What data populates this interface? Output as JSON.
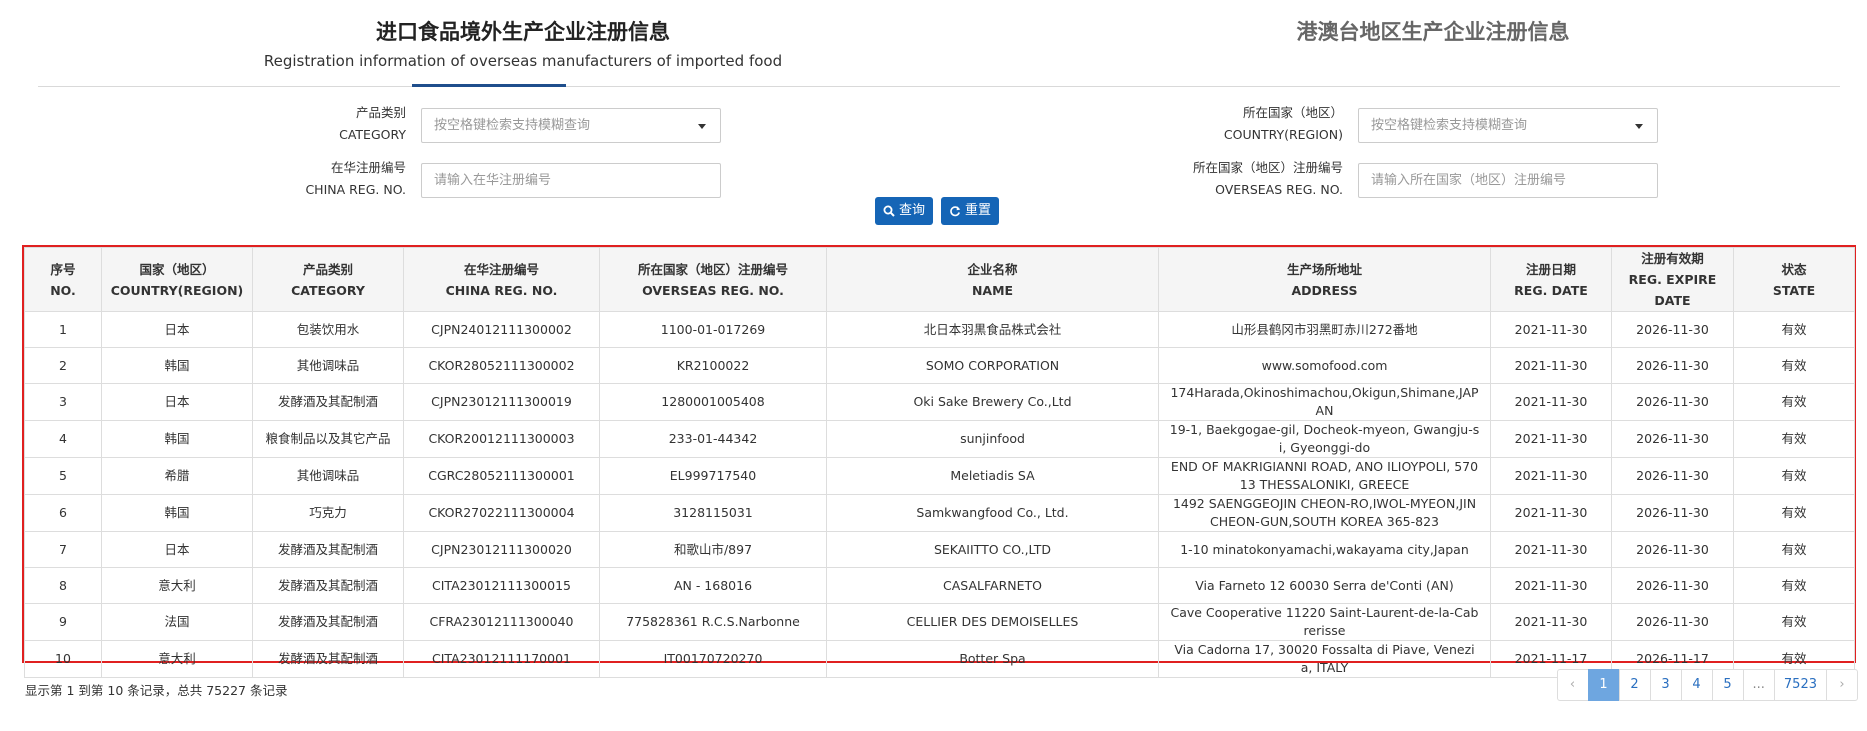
{
  "tabs": {
    "main_title": "进口食品境外生产企业注册信息",
    "main_subtitle": "Registration information of overseas manufacturers of imported food",
    "hk_title": "港澳台地区生产企业注册信息"
  },
  "filters": {
    "category_label_cn": "产品类别",
    "category_label_en": "CATEGORY",
    "category_placeholder": "按空格键检索支持模糊查询",
    "china_reg_label_cn": "在华注册编号",
    "china_reg_label_en": "CHINA REG. NO.",
    "china_reg_placeholder": "请输入在华注册编号",
    "country_label_cn": "所在国家（地区）",
    "country_label_en": "COUNTRY(REGION)",
    "country_placeholder": "按空格键检索支持模糊查询",
    "overseas_reg_label_cn": "所在国家（地区）注册编号",
    "overseas_reg_label_en": "OVERSEAS REG. NO.",
    "overseas_reg_placeholder": "请输入所在国家（地区）注册编号",
    "search_label": "查询",
    "reset_label": "重置"
  },
  "table": {
    "headers": [
      {
        "cn": "序号",
        "en": "NO."
      },
      {
        "cn": "国家（地区）",
        "en": "COUNTRY(REGION)"
      },
      {
        "cn": "产品类别",
        "en": "CATEGORY"
      },
      {
        "cn": "在华注册编号",
        "en": "CHINA REG. NO."
      },
      {
        "cn": "所在国家（地区）注册编号",
        "en": "OVERSEAS REG. NO."
      },
      {
        "cn": "企业名称",
        "en": "NAME"
      },
      {
        "cn": "生产场所地址",
        "en": "ADDRESS"
      },
      {
        "cn": "注册日期",
        "en": "REG. DATE"
      },
      {
        "cn": "注册有效期",
        "en": "REG. EXPIRE DATE"
      },
      {
        "cn": "状态",
        "en": "STATE"
      }
    ],
    "rows": [
      [
        "1",
        "日本",
        "包装饮用水",
        "CJPN24012111300002",
        "1100-01-017269",
        "北日本羽黒食品株式会社",
        "山形县鹤冈市羽黑町赤川272番地",
        "2021-11-30",
        "2026-11-30",
        "有效"
      ],
      [
        "2",
        "韩国",
        "其他调味品",
        "CKOR28052111300002",
        "KR2100022",
        "SOMO CORPORATION",
        "www.somofood.com",
        "2021-11-30",
        "2026-11-30",
        "有效"
      ],
      [
        "3",
        "日本",
        "发酵酒及其配制酒",
        "CJPN23012111300019",
        "1280001005408",
        "Oki Sake Brewery Co.,Ltd",
        "174Harada,Okinoshimachou,Okigun,Shimane,JAPAN",
        "2021-11-30",
        "2026-11-30",
        "有效"
      ],
      [
        "4",
        "韩国",
        "粮食制品以及其它产品",
        "CKOR20012111300003",
        "233-01-44342",
        "sunjinfood",
        "19-1, Baekgogae-gil, Docheok-myeon, Gwangju-si, Gyeonggi-do",
        "2021-11-30",
        "2026-11-30",
        "有效"
      ],
      [
        "5",
        "希腊",
        "其他调味品",
        "CGRC28052111300001",
        "EL999717540",
        "Meletiadis SA",
        "END OF MAKRIGIANNI ROAD, ANO ILIOYPOLI, 57013 THESSALONIKI, GREECE",
        "2021-11-30",
        "2026-11-30",
        "有效"
      ],
      [
        "6",
        "韩国",
        "巧克力",
        "CKOR27022111300004",
        "3128115031",
        "Samkwangfood Co., Ltd.",
        "1492 SAENGGEOJIN CHEON-RO,IWOL-MYEON,JINCHEON-GUN,SOUTH KOREA 365-823",
        "2021-11-30",
        "2026-11-30",
        "有效"
      ],
      [
        "7",
        "日本",
        "发酵酒及其配制酒",
        "CJPN23012111300020",
        "和歌山市/897",
        "SEKAIITTO CO.,LTD",
        "1-10 minatokonyamachi,wakayama city,Japan",
        "2021-11-30",
        "2026-11-30",
        "有效"
      ],
      [
        "8",
        "意大利",
        "发酵酒及其配制酒",
        "CITA23012111300015",
        "AN - 168016",
        "CASALFARNETO",
        "Via Farneto 12 60030 Serra de'Conti (AN)",
        "2021-11-30",
        "2026-11-30",
        "有效"
      ],
      [
        "9",
        "法国",
        "发酵酒及其配制酒",
        "CFRA23012111300040",
        "775828361 R.C.S.Narbonne",
        "CELLIER DES DEMOISELLES",
        "Cave Cooperative 11220 Saint-Laurent-de-la-Cabrerisse",
        "2021-11-30",
        "2026-11-30",
        "有效"
      ],
      [
        "10",
        "意大利",
        "发酵酒及其配制酒",
        "CITA23012111170001",
        "IT00170720270",
        "Botter Spa",
        "Via Cadorna 17, 30020 Fossalta di Piave, Venezia, ITALY",
        "2021-11-17",
        "2026-11-17",
        "有效"
      ]
    ]
  },
  "footer": {
    "summary": "显示第 1 到第 10 条记录，总共 75227 条记录",
    "pages": [
      "‹",
      "1",
      "2",
      "3",
      "4",
      "5",
      "...",
      "7523",
      "›"
    ],
    "active_page": "1"
  },
  "colors": {
    "brand_blue": "#1565b6",
    "table_border_highlight": "#e02020",
    "active_page": "#6ea6e0"
  }
}
